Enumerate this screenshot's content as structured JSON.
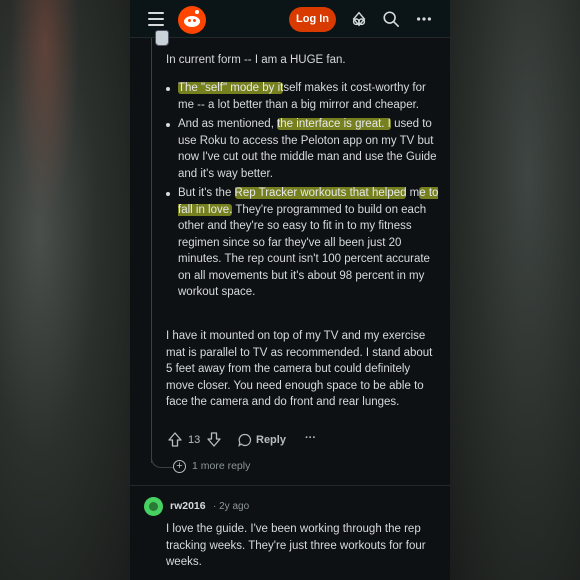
{
  "header": {
    "login_label": "Log In"
  },
  "comment": {
    "intro": "In current form -- I am a HUGE fan.",
    "bullet1_hl": "The \"self\" mode by it",
    "bullet1_rest": "self makes it cost-worthy for me -- a lot better than a big mirror and cheaper.",
    "bullet2_pre": "And as mentioned, ",
    "bullet2_hl": "the interface is great. I",
    "bullet2_rest": " used to use Roku to access the Peloton app on my TV but now I've cut out the middle man and use the Guide and it's way better.",
    "bullet3_pre": "But it's the ",
    "bullet3_hl1": "Rep Tracker workouts that helped",
    "bullet3_mid": " m",
    "bullet3_hl2": "e to fall in love.",
    "bullet3_rest": " They're programmed to build on each other and they're so easy to fit in to my fitness regimen since so far they've all been just 20 minutes. The rep count isn't 100 percent accurate on all movements but it's about 98 percent in my workout space.",
    "mounting": "I have it mounted on top of my TV and my exercise mat is parallel to TV as recommended. I stand about 5 feet away from the camera but could definitely move closer. You need enough space to be able to face the camera and do front and rear lunges.",
    "vote_count": "13",
    "reply_label": "Reply",
    "more_label": "···",
    "more_replies": "1 more reply"
  },
  "reply2": {
    "username": "rw2016",
    "time": "· 2y ago",
    "body": "I love the guide. I've been working through the rep tracking weeks. They're just three workouts for four weeks."
  },
  "icons": {
    "menu": "hamburger-icon",
    "logo": "reddit-logo",
    "advertise": "advertise-icon",
    "search": "search-icon",
    "overflow": "overflow-menu-icon",
    "upvote": "upvote-icon",
    "downvote": "downvote-icon",
    "reply": "reply-bubble-icon",
    "expand": "plus-circle-icon"
  },
  "colors": {
    "accent": "#d93a00",
    "highlight": "#cddc28",
    "background": "#0e1113"
  }
}
